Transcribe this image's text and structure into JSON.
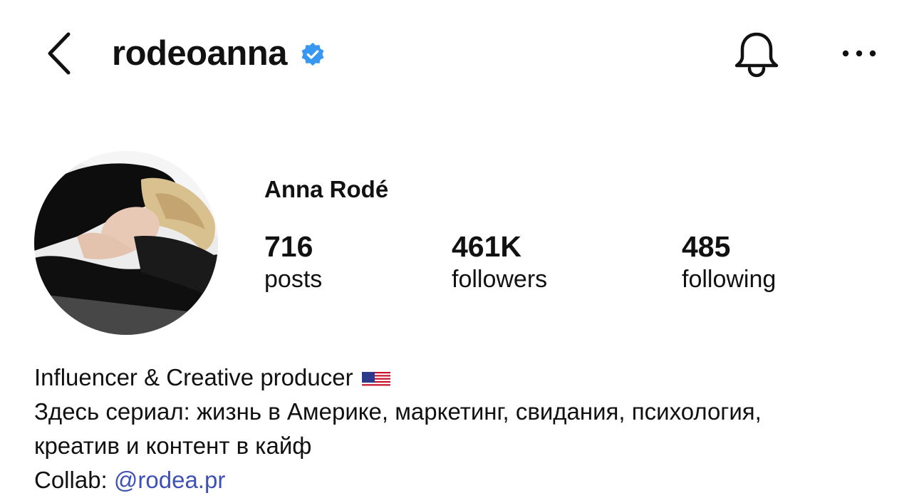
{
  "header": {
    "username": "rodeoanna",
    "icons": {
      "back": "chevron-left-icon",
      "verified": "verified-badge-icon",
      "notifications": "bell-icon",
      "more": "more-horizontal-icon"
    }
  },
  "profile": {
    "full_name": "Anna Rodé",
    "stats": [
      {
        "value": "716",
        "label": "posts"
      },
      {
        "value": "461K",
        "label": "followers"
      },
      {
        "value": "485",
        "label": "following"
      }
    ]
  },
  "bio": {
    "line1": "Influencer & Creative producer",
    "line1_flag": "us-flag-icon",
    "line2": "Здесь сериал: жизнь в Америке, маркетинг, свидания, психология,",
    "line3": "креатив и контент в кайф",
    "collab_prefix": "Collab: ",
    "collab_handle": "@rodea.pr"
  },
  "colors": {
    "verified": "#3897f0",
    "link": "#3f51b5",
    "text": "#111111",
    "background": "#ffffff"
  }
}
